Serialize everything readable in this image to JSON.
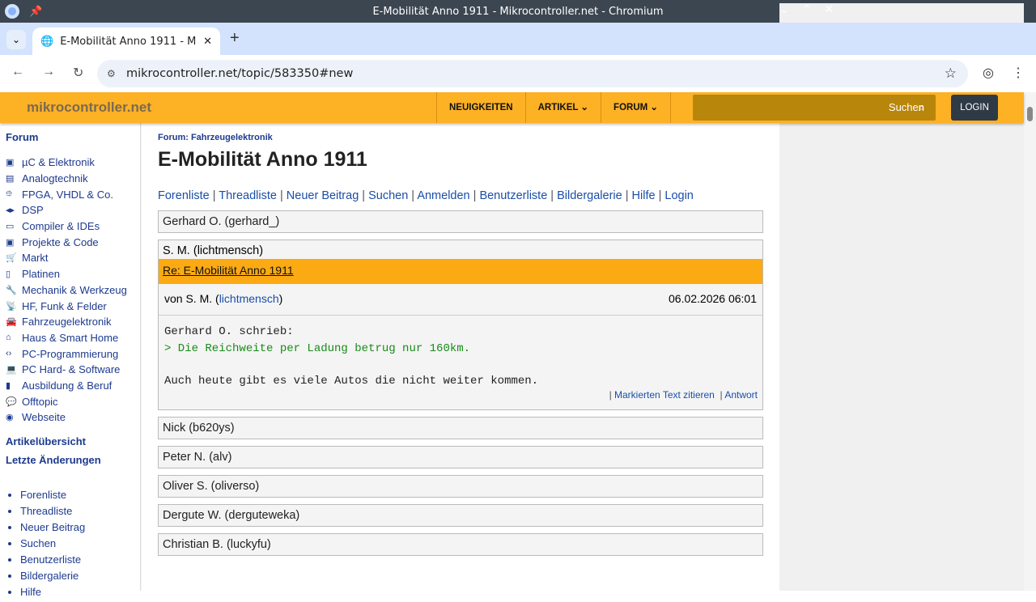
{
  "window": {
    "title": "E-Mobilität Anno 1911 - Mikrocontroller.net - Chromium"
  },
  "tab": {
    "title": "E-Mobilität Anno 1911 - Mikrocontroller.net"
  },
  "address": {
    "url": "mikrocontroller.net/topic/583350#new"
  },
  "header": {
    "logo": "mikrocontroller.net",
    "menu": [
      "NEUIGKEITEN",
      "ARTIKEL ⌄",
      "FORUM ⌄"
    ],
    "search_placeholder": "Suchen",
    "login": "LOGIN"
  },
  "sidebar": {
    "title": "Forum",
    "items": [
      {
        "icon": "chip-icon",
        "label": "µC & Elektronik"
      },
      {
        "icon": "oscilloscope-icon",
        "label": "Analogtechnik"
      },
      {
        "icon": "fpga-icon",
        "label": "FPGA, VHDL & Co."
      },
      {
        "icon": "signal-icon",
        "label": "DSP"
      },
      {
        "icon": "monitor-icon",
        "label": "Compiler & IDEs"
      },
      {
        "icon": "project-icon",
        "label": "Projekte & Code"
      },
      {
        "icon": "cart-icon",
        "label": "Markt"
      },
      {
        "icon": "board-icon",
        "label": "Platinen"
      },
      {
        "icon": "wrench-icon",
        "label": "Mechanik & Werkzeug"
      },
      {
        "icon": "antenna-icon",
        "label": "HF, Funk & Felder"
      },
      {
        "icon": "car-icon",
        "label": "Fahrzeugelektronik"
      },
      {
        "icon": "home-icon",
        "label": "Haus & Smart Home"
      },
      {
        "icon": "code-icon",
        "label": "PC-Programmierung"
      },
      {
        "icon": "laptop-icon",
        "label": "PC Hard- & Software"
      },
      {
        "icon": "book-icon",
        "label": "Ausbildung & Beruf"
      },
      {
        "icon": "chat-icon",
        "label": "Offtopic"
      },
      {
        "icon": "globe-icon",
        "label": "Webseite"
      }
    ],
    "artikel": "Artikelübersicht",
    "changes": "Letzte Änderungen",
    "list": [
      "Forenliste",
      "Threadliste",
      "Neuer Beitrag",
      "Suchen",
      "Benutzerliste",
      "Bildergalerie",
      "Hilfe"
    ]
  },
  "main": {
    "breadcrumb": "Forum: Fahrzeugelektronik",
    "title": "E-Mobilität Anno 1911",
    "links": [
      "Forenliste",
      "Threadliste",
      "Neuer Beitrag",
      "Suchen",
      "Anmelden",
      "Benutzerliste",
      "Bildergalerie",
      "Hilfe",
      "Login"
    ],
    "post_before": "Gerhard O. (gerhard_)",
    "open_post": {
      "author": "S. M. (lichtmensch)",
      "subject": "Re: E-Mobilität Anno 1911",
      "by": "von S. M. (",
      "user": "lichtmensch",
      "by_end": ")",
      "date": "06.02.2026 06:01",
      "quote_intro": "Gerhard O. schrieb:",
      "quote": "> Die Reichweite per Ladung betrug nur 160km.",
      "text": "Auch heute gibt es viele Autos die nicht weiter kommen.",
      "cite": "Markierten Text zitieren",
      "reply": "Antwort"
    },
    "posts_after": [
      "Nick (b620ys)",
      "Peter N. (alv)",
      "Oliver S. (oliverso)",
      "Dergute W. (derguteweka)",
      "Christian B. (luckyfu)"
    ]
  }
}
